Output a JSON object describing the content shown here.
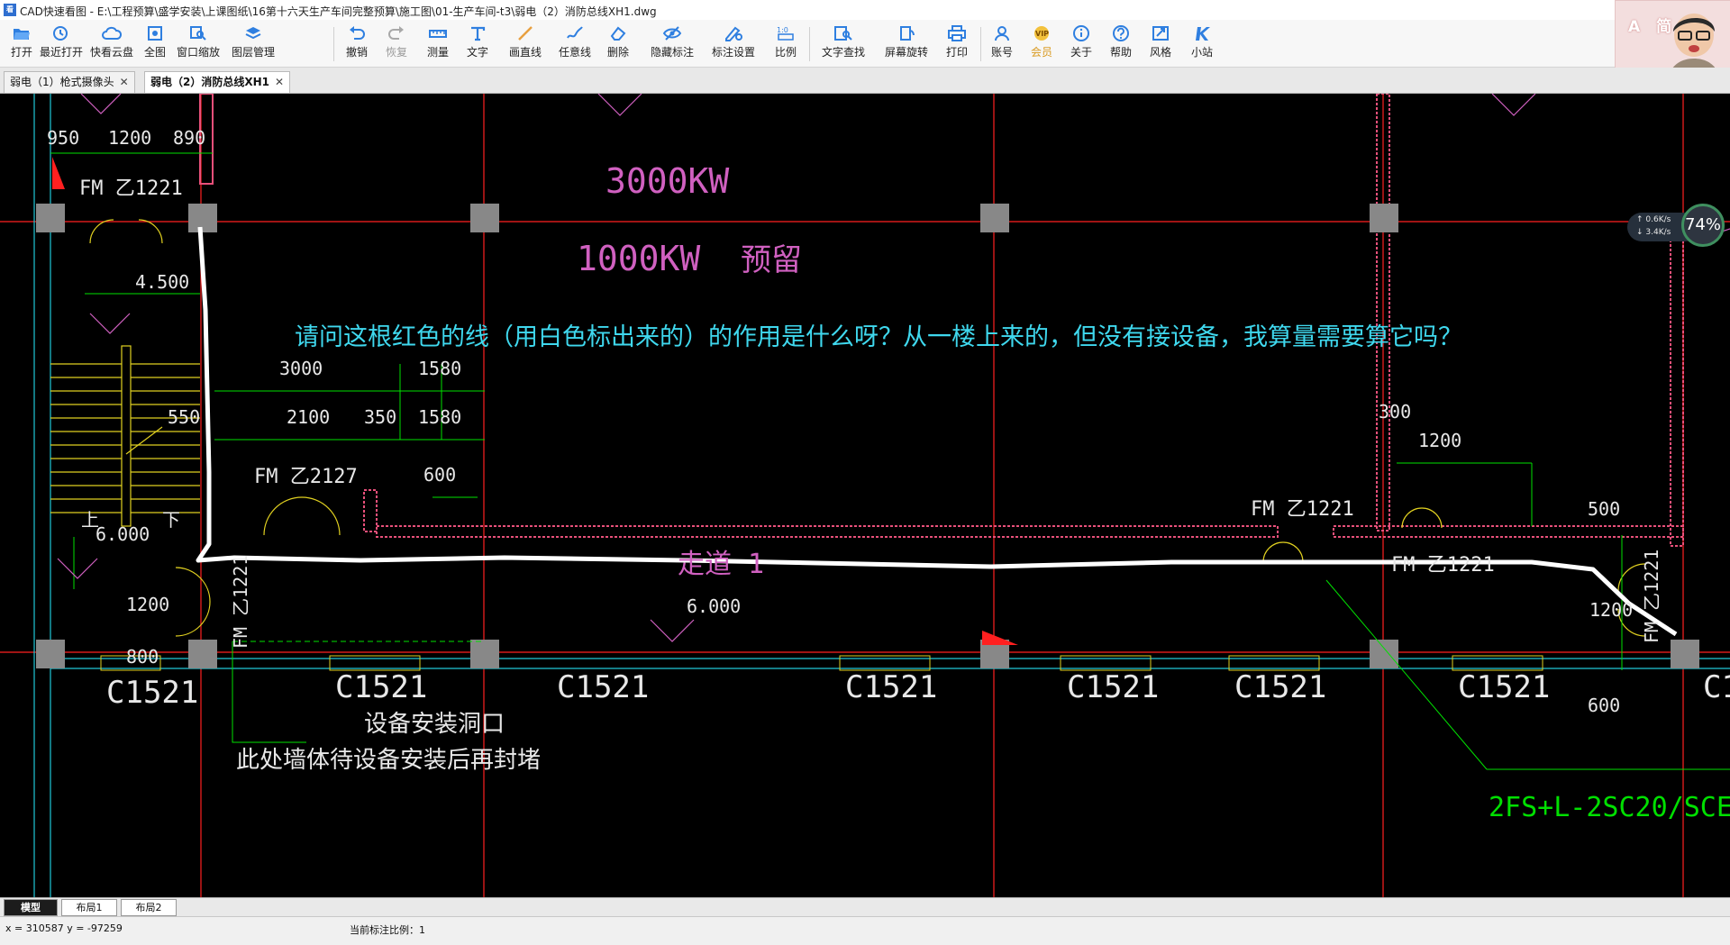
{
  "window": {
    "title": "CAD快速看图 - E:\\工程预算\\盛学安装\\上课图纸\\16第十六天生产车间完整预算\\施工图\\01-生产车间-t3\\弱电（2）消防总线XH1.dwg",
    "app_icon": "看"
  },
  "toolbar": {
    "items": [
      {
        "label": "打开",
        "icon": "folder-open-icon",
        "enabled": true
      },
      {
        "label": "最近打开",
        "icon": "history-icon",
        "enabled": true
      },
      {
        "label": "快看云盘",
        "icon": "cloud-icon",
        "enabled": true
      },
      {
        "label": "全图",
        "icon": "fit-all-icon",
        "enabled": true
      },
      {
        "label": "窗口缩放",
        "icon": "window-zoom-icon",
        "enabled": true
      },
      {
        "label": "图层管理",
        "icon": "layers-icon",
        "enabled": true
      },
      {
        "label": "撤销",
        "icon": "undo-icon",
        "enabled": true
      },
      {
        "label": "恢复",
        "icon": "redo-icon",
        "enabled": false
      },
      {
        "label": "测量",
        "icon": "ruler-icon",
        "enabled": true
      },
      {
        "label": "文字",
        "icon": "text-icon",
        "enabled": true
      },
      {
        "label": "画直线",
        "icon": "line-icon",
        "enabled": true
      },
      {
        "label": "任意线",
        "icon": "freehand-icon",
        "enabled": true
      },
      {
        "label": "删除",
        "icon": "eraser-icon",
        "enabled": true
      },
      {
        "label": "隐藏标注",
        "icon": "hide-eye-icon",
        "enabled": true
      },
      {
        "label": "标注设置",
        "icon": "annotation-settings-icon",
        "enabled": true
      },
      {
        "label": "比例",
        "icon": "scale-icon",
        "enabled": true
      },
      {
        "label": "文字查找",
        "icon": "text-search-icon",
        "enabled": true
      },
      {
        "label": "屏幕旋转",
        "icon": "rotate-screen-icon",
        "enabled": true
      },
      {
        "label": "打印",
        "icon": "printer-icon",
        "enabled": true
      },
      {
        "label": "账号",
        "icon": "account-icon",
        "enabled": true
      },
      {
        "label": "会员",
        "icon": "vip-icon",
        "enabled": true
      },
      {
        "label": "关于",
        "icon": "info-icon",
        "enabled": true
      },
      {
        "label": "帮助",
        "icon": "help-icon",
        "enabled": true
      },
      {
        "label": "风格",
        "icon": "style-icon",
        "enabled": true
      },
      {
        "label": "小站",
        "icon": "station-icon",
        "enabled": true
      }
    ]
  },
  "user_panel": {
    "initials": "A 简"
  },
  "doc_tabs": [
    {
      "label": "弱电（1）枪式摄像头",
      "active": false
    },
    {
      "label": "弱电（2）消防总线XH1",
      "active": true
    }
  ],
  "drawing": {
    "question": "请问这根红色的线（用白色标出来的）的作用是什么呀？从一楼上来的，但没有接设备，我算量需要算它吗？",
    "power_labels": [
      "3000KW",
      "1000KW",
      "预留"
    ],
    "dimensions": [
      "950",
      "1200",
      "890",
      "4.500",
      "3000",
      "1580",
      "2100",
      "350",
      "1580",
      "550",
      "600",
      "6.000",
      "1200",
      "800",
      "6.000",
      "300",
      "1200",
      "500",
      "1200",
      "600"
    ],
    "door_labels": [
      "FM 乙1221",
      "FM 乙2127",
      "FM 乙1221",
      "FM 乙1221",
      "FM 乙1221",
      "FM 乙1221"
    ],
    "corridor_label": "走道 1",
    "window_labels": [
      "C1521",
      "C1521",
      "C1521",
      "C1521",
      "C1521",
      "C1521",
      "C1521",
      "C1"
    ],
    "stair_up": "上",
    "stair_down": "下",
    "notes": [
      "设备安装洞口",
      "此处墙体待设备安装后再封堵"
    ],
    "cable_label": "2FS+L-2SC20/SCE",
    "colors": {
      "axis_red": "#ff2020",
      "wall_pink": "#e8507a",
      "dim_green": "#00e000",
      "text_magenta": "#d060c0",
      "window_cyan": "#20c8d8",
      "question_cyan": "#3fd8ee",
      "highlight_white": "#ffffff"
    }
  },
  "net_widget": {
    "upload": "0.6K/s",
    "download": "3.4K/s",
    "percent": "74%"
  },
  "layout_tabs": [
    {
      "label": "模型",
      "active": true
    },
    {
      "label": "布局1",
      "active": false
    },
    {
      "label": "布局2",
      "active": false
    }
  ],
  "status": {
    "coords": "x = 310587  y = -97259",
    "scale": "当前标注比例：1"
  }
}
